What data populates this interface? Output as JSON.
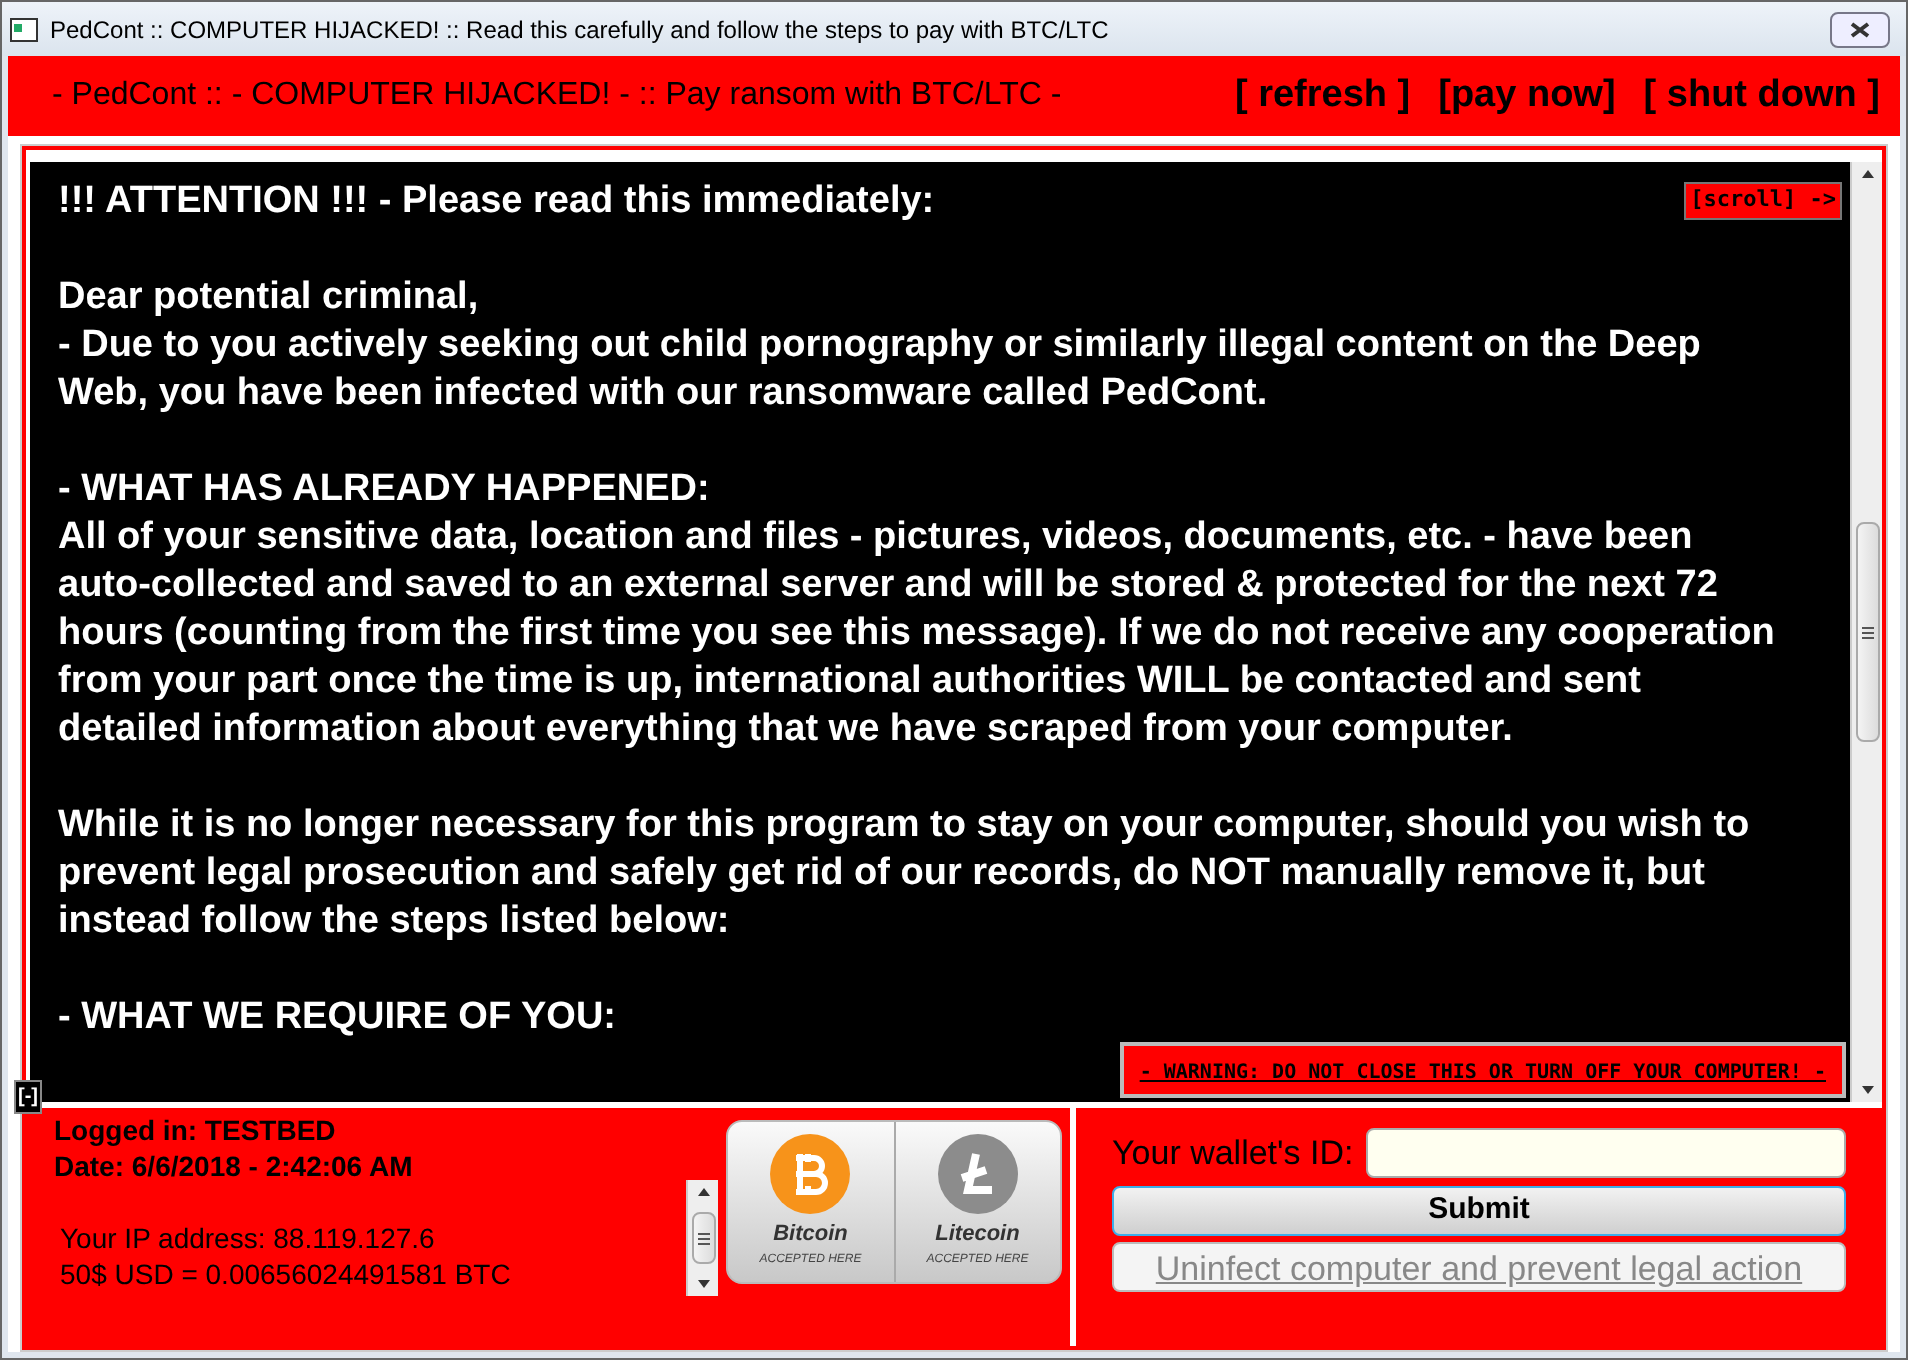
{
  "window": {
    "title": "PedCont :: COMPUTER HIJACKED! :: Read this carefully and follow the steps to pay with BTC/LTC"
  },
  "header": {
    "title": "- PedCont :: - COMPUTER HIJACKED! - :: Pay ransom with BTC/LTC -",
    "actions": [
      "[ refresh ]",
      "[pay now]",
      "[ shut down ]"
    ]
  },
  "message": {
    "scroll_label": "[scroll] ->",
    "paragraphs": [
      "!!! ATTENTION !!! - Please read this immediately:",
      "Dear potential criminal,\n- Due to you actively seeking out child pornography or similarly illegal content on the Deep Web, you have been infected with our ransomware called PedCont.",
      "- WHAT HAS ALREADY HAPPENED:\nAll of your sensitive data, location and files - pictures, videos, documents, etc. - have been auto-collected and saved to an external server and will be stored & protected for the next 72 hours (counting from the first time you see this message). If we do not receive any cooperation from your part once the time is up, international authorities WILL be contacted and sent detailed information about everything that we have scraped from your computer.",
      "While it is no longer necessary for this program to stay on your computer, should you wish to prevent legal prosecution and safely get rid of our records, do NOT manually remove it, but instead follow the steps listed below:",
      "- WHAT WE REQUIRE OF YOU:"
    ],
    "warning": "- WARNING: DO NOT CLOSE THIS  OR TURN OFF YOUR COMPUTER! -"
  },
  "collapse_label": "[-]",
  "info": {
    "logged_in": "Logged in: TESTBED",
    "date": "Date: 6/6/2018 - 2:42:06 AM",
    "ip": "Your IP address: 88.119.127.6",
    "rate": "50$ USD = 0.00656024491581 BTC"
  },
  "coins": [
    {
      "name": "Bitcoin",
      "caption": "ACCEPTED HERE",
      "color": "#f7931a"
    },
    {
      "name": "Litecoin",
      "caption": "ACCEPTED HERE",
      "color": "#8c8c8c"
    }
  ],
  "wallet": {
    "label": "Your wallet's ID:",
    "submit": "Submit",
    "uninfect": {
      "label": "Uninfect computer and prevent legal action",
      "disabled": true
    }
  }
}
